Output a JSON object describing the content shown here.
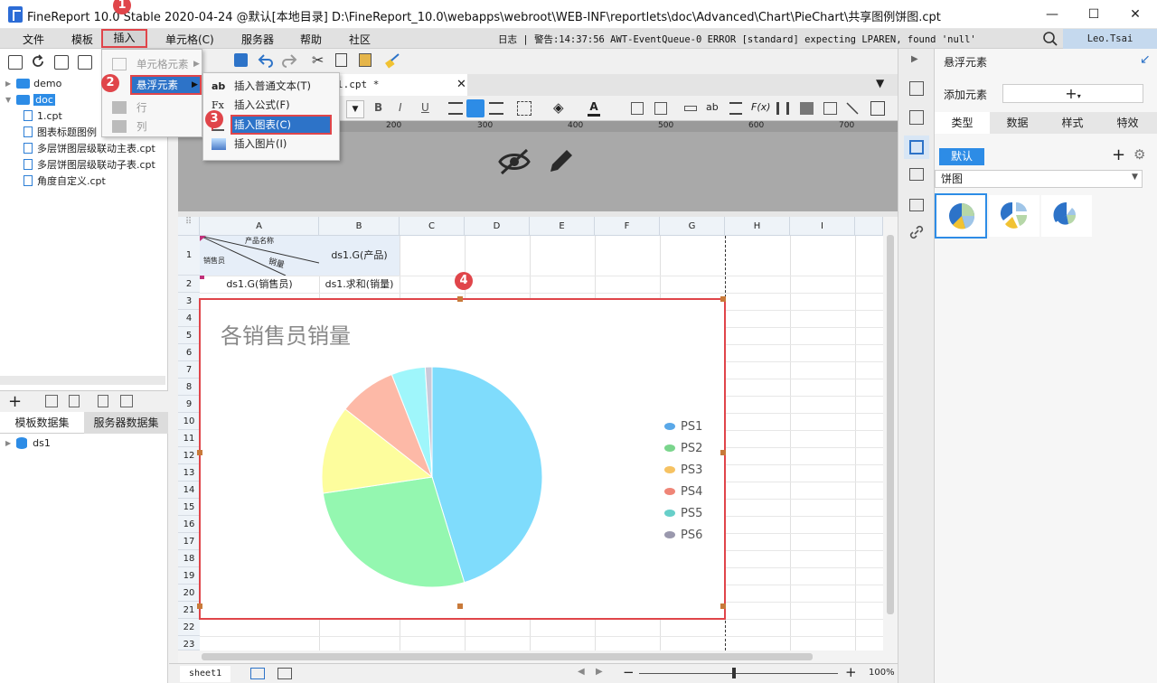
{
  "window": {
    "title": "FineReport 10.0  Stable 2020-04-24 @默认[本地目录]    D:\\FineReport_10.0\\webapps\\webroot\\WEB-INF\\reportlets\\doc\\Advanced\\Chart\\PieChart\\共享图例饼图.cpt",
    "minimize": "—",
    "maximize": "☐",
    "close": "✕"
  },
  "menubar": {
    "items": [
      "文件",
      "模板",
      "插入",
      "单元格(C)",
      "服务器",
      "帮助",
      "社区"
    ],
    "log": "日志 | 警告:14:37:56 AWT-EventQueue-0 ERROR [standard] expecting LPAREN, found 'null'",
    "user": "Leo.Tsai"
  },
  "insert_menu": {
    "items": [
      "单元格元素",
      "悬浮元素",
      "行",
      "列"
    ]
  },
  "float_submenu": {
    "items": [
      {
        "icon": "ab",
        "label": "插入普通文本(T)"
      },
      {
        "icon": "Fx",
        "label": "插入公式(F)"
      },
      {
        "icon": "chart",
        "label": "插入图表(C)"
      },
      {
        "icon": "image",
        "label": "插入图片(I)"
      }
    ]
  },
  "badges": [
    "1",
    "2",
    "3",
    "4"
  ],
  "tree": {
    "items": [
      "demo",
      "doc",
      "1.cpt",
      "图表标题图例",
      "多层饼图层级联动主表.cpt",
      "多层饼图层级联动子表.cpt",
      "角度自定义.cpt"
    ]
  },
  "dataset": {
    "tabs": [
      "模板数据集",
      "服务器数据集"
    ],
    "items": [
      "ds1"
    ]
  },
  "tab": {
    "label": "l.cpt *"
  },
  "ruler": [
    "200",
    "300",
    "400",
    "500",
    "600",
    "700"
  ],
  "columns": [
    "A",
    "B",
    "C",
    "D",
    "E",
    "F",
    "G",
    "H",
    "I"
  ],
  "rows": [
    "1",
    "2",
    "3",
    "4",
    "5",
    "6",
    "7",
    "8",
    "9",
    "10",
    "11",
    "12",
    "13",
    "14",
    "15",
    "16",
    "17",
    "18",
    "19",
    "20",
    "21",
    "22",
    "23"
  ],
  "cells": {
    "a1_top": "产品名称",
    "a1_bottom": "销售员",
    "a1_mid": "销量",
    "b1": "ds1.G(产品)",
    "a2": "ds1.G(销售员)",
    "b2": "ds1.求和(销量)"
  },
  "chart_data": {
    "type": "pie",
    "title": "各销售员销量",
    "categories": [
      "PS1",
      "PS2",
      "PS3",
      "PS4",
      "PS5",
      "PS6"
    ],
    "values": [
      45.5,
      27.5,
      13.0,
      8.5,
      5.0,
      1.0
    ],
    "colors": [
      "#7fdcfc",
      "#94f7b0",
      "#fdfd9d",
      "#fdb9a7",
      "#9ff6fb",
      "#c9c9d9"
    ],
    "legend_colors": [
      "#5aa8e8",
      "#7ad58c",
      "#f6c262",
      "#ef8577",
      "#67cfc9",
      "#9a98ad"
    ],
    "legend": "right"
  },
  "right_panel": {
    "header": "悬浮元素",
    "add_label": "添加元素",
    "tabs": [
      "类型",
      "数据",
      "样式",
      "特效"
    ],
    "default_btn": "默认",
    "chart_type": "饼图"
  },
  "bottom": {
    "sheet": "sheet1",
    "zoom": "100%"
  }
}
